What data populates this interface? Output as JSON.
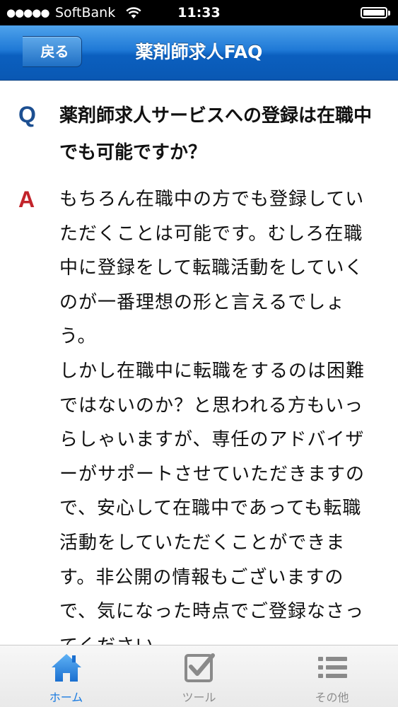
{
  "status_bar": {
    "signal": "●●●●●",
    "carrier": "SoftBank",
    "time": "11:33"
  },
  "nav": {
    "back_label": "戻る",
    "title": "薬剤師求人FAQ"
  },
  "faq": {
    "q_mark": "Q",
    "question": "薬剤師求人サービスへの登録は在職中でも可能ですか？",
    "a_mark": "A",
    "answer": "もちろん在職中の方でも登録していただくことは可能です。むしろ在職中に登録をして転職活動をしていくのが一番理想の形と言えるでしょう。\nしかし在職中に転職をするのは困難ではないのか？と思われる方もいっらしゃいますが、専任のアドバイザーがサポートさせていただきますので、安心して在職中であっても転職活動をしていただくことができます。非公開の情報もございますので、気になった時点でご登録なさってください。"
  },
  "tab_bar": {
    "tabs": [
      {
        "label": "ホーム",
        "icon": "home-icon",
        "selected": true
      },
      {
        "label": "ツール",
        "icon": "checkbox-icon",
        "selected": false
      },
      {
        "label": "その他",
        "icon": "list-icon",
        "selected": false
      }
    ]
  },
  "colors": {
    "nav_blue": "#1f79d6",
    "q_blue": "#1c4f91",
    "a_red": "#c2242b",
    "tab_selected": "#1a7be0",
    "tab_unselected": "#8e8e8e"
  }
}
